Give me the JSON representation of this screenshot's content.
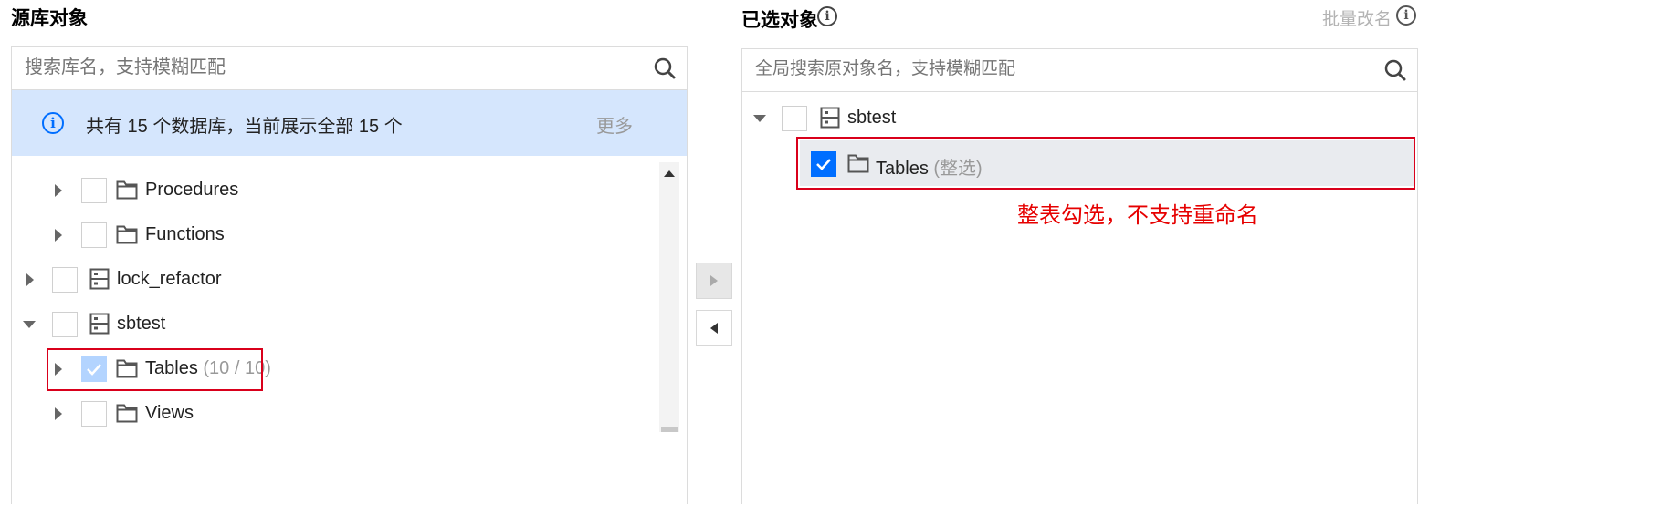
{
  "left": {
    "title": "源库对象",
    "search_placeholder": "搜索库名，支持模糊匹配",
    "notice": {
      "text": "共有 15 个数据库，当前展示全部 15 个",
      "more_label": "更多"
    },
    "tree": [
      {
        "label": "Procedures",
        "level": 1,
        "type": "folder",
        "expanded": false,
        "checked": false
      },
      {
        "label": "Functions",
        "level": 1,
        "type": "folder",
        "expanded": false,
        "checked": false
      },
      {
        "label": "lock_refactor",
        "level": 0,
        "type": "database",
        "expanded": false,
        "checked": false
      },
      {
        "label": "sbtest",
        "level": 0,
        "type": "database",
        "expanded": true,
        "checked": false
      },
      {
        "label": "Tables",
        "count": "(10 / 10)",
        "level": 1,
        "type": "folder",
        "expanded": false,
        "checked": true
      },
      {
        "label": "Views",
        "level": 1,
        "type": "folder",
        "expanded": false,
        "checked": false
      }
    ]
  },
  "right": {
    "title": "已选对象",
    "batch_rename_label": "批量改名",
    "search_placeholder": "全局搜索原对象名，支持模糊匹配",
    "tree": [
      {
        "label": "sbtest",
        "level": 0,
        "type": "database",
        "expanded": true,
        "checked": false
      },
      {
        "label": "Tables",
        "tag": "(整选)",
        "level": 1,
        "type": "folder",
        "checked": true
      }
    ],
    "annotation": "整表勾选，不支持重命名"
  },
  "colors": {
    "accent": "#006eff",
    "notice_bg": "#d5e6fd",
    "annotation_red": "#e60000",
    "highlight_border": "#d9001b",
    "selected_row_bg": "#e9ebef"
  }
}
